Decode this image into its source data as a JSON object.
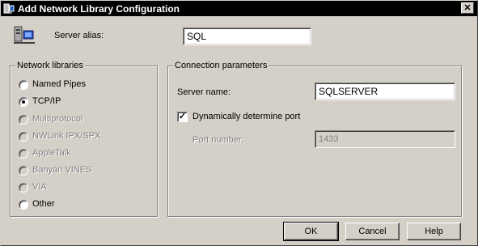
{
  "window": {
    "title": "Add Network Library Configuration",
    "close_glyph": "✕"
  },
  "alias": {
    "label": "Server alias:",
    "value": "SQL"
  },
  "network_libraries": {
    "label": "Network libraries",
    "selected": "TCP/IP",
    "items": [
      {
        "label": "Named Pipes",
        "enabled": true,
        "selected": false
      },
      {
        "label": "TCP/IP",
        "enabled": true,
        "selected": true
      },
      {
        "label": "Multiprotocol",
        "enabled": false,
        "selected": false
      },
      {
        "label": "NWLink IPX/SPX",
        "enabled": false,
        "selected": false
      },
      {
        "label": "AppleTalk",
        "enabled": false,
        "selected": false
      },
      {
        "label": "Banyan VINES",
        "enabled": false,
        "selected": false
      },
      {
        "label": "VIA",
        "enabled": false,
        "selected": false
      },
      {
        "label": "Other",
        "enabled": true,
        "selected": false
      }
    ]
  },
  "connection": {
    "label": "Connection parameters",
    "server_name_label": "Server name:",
    "server_name_value": "SQLSERVER",
    "dynamic_port_label": "Dynamically determine port",
    "dynamic_port_checked": true,
    "port_label": "Port number:",
    "port_value": "1433"
  },
  "buttons": {
    "ok": "OK",
    "cancel": "Cancel",
    "help": "Help"
  },
  "icons": {
    "title": "network-config-icon",
    "alias": "server-network-icon",
    "close": "close-icon"
  }
}
